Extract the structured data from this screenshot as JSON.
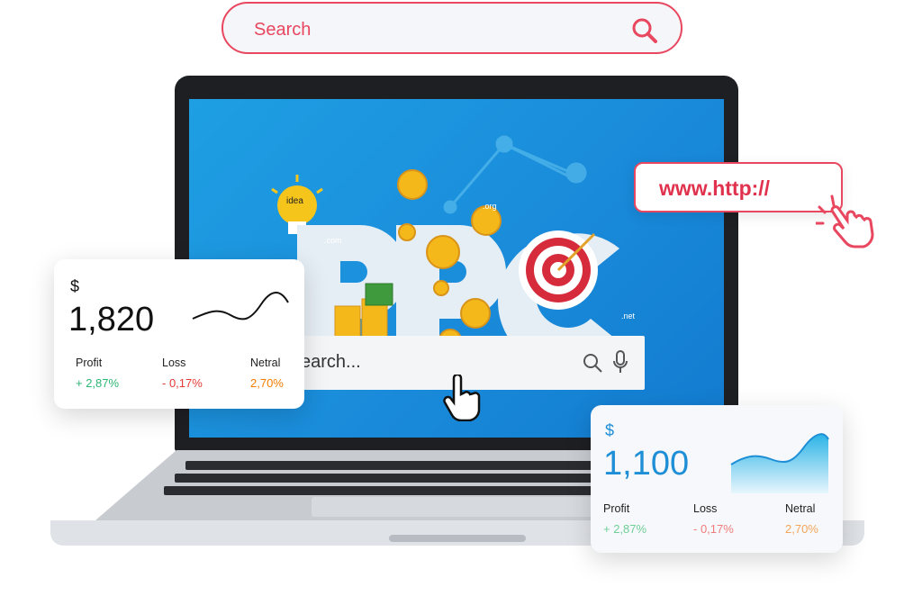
{
  "search": {
    "placeholder": "Search"
  },
  "screen": {
    "logo_text": "PPC",
    "search_text": "earch...",
    "tags": [
      ".com",
      ".org",
      ".net",
      "idea"
    ]
  },
  "url_bubble": {
    "text": "www.http://"
  },
  "cards": [
    {
      "currency": "$",
      "amount": "1,820",
      "stats": [
        {
          "label": "Profit",
          "value": "+ 2,87%"
        },
        {
          "label": "Loss",
          "value": "- 0,17%"
        },
        {
          "label": "Netral",
          "value": "2,70%"
        }
      ]
    },
    {
      "currency": "$",
      "amount": "1,100",
      "stats": [
        {
          "label": "Profit",
          "value": "+ 2,87%"
        },
        {
          "label": "Loss",
          "value": "- 0,17%"
        },
        {
          "label": "Netral",
          "value": "2,70%"
        }
      ]
    }
  ],
  "colors": {
    "accent": "#e8475f",
    "profit": "#2bb673",
    "loss": "#e53935",
    "netral": "#f57c00",
    "blue": "#1e8fd6"
  }
}
